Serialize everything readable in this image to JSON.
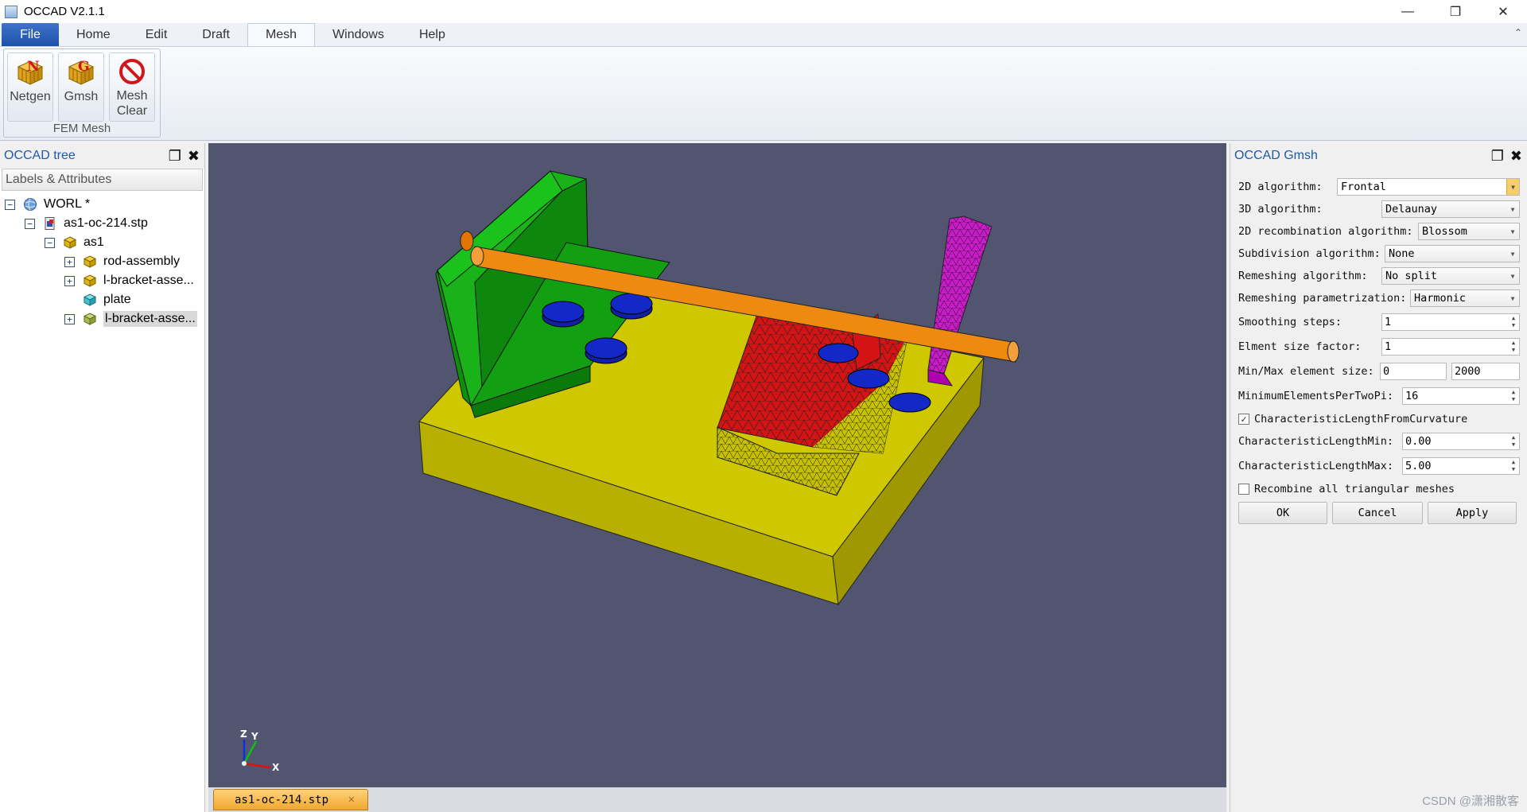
{
  "window": {
    "title": "OCCAD V2.1.1"
  },
  "menu": {
    "tabs": [
      "File",
      "Home",
      "Edit",
      "Draft",
      "Mesh",
      "Windows",
      "Help"
    ],
    "active": "Mesh"
  },
  "ribbon": {
    "group_caption": "FEM Mesh",
    "buttons": [
      {
        "label": "Netgen"
      },
      {
        "label": "Gmsh"
      },
      {
        "label_line1": "Mesh",
        "label_line2": "Clear"
      }
    ]
  },
  "tree_panel": {
    "title": "OCCAD tree",
    "header": "Labels & Attributes",
    "items": [
      {
        "label": "WORL *"
      },
      {
        "label": "as1-oc-214.stp"
      },
      {
        "label": "as1"
      },
      {
        "label": "rod-assembly"
      },
      {
        "label": "l-bracket-asse..."
      },
      {
        "label": "plate"
      },
      {
        "label": "l-bracket-asse..."
      }
    ]
  },
  "viewport": {
    "axis_labels": {
      "z": "Z",
      "y": "Y",
      "x": "X"
    }
  },
  "document_tab": {
    "label": "as1-oc-214.stp"
  },
  "gmsh_panel": {
    "title": "OCCAD Gmsh",
    "algo2d": {
      "label": "2D algorithm:",
      "value": "Frontal"
    },
    "algo3d": {
      "label": "3D algorithm:",
      "value": "Delaunay"
    },
    "recomb2d": {
      "label": "2D recombination algorithm:",
      "value": "Blossom"
    },
    "subdiv": {
      "label": "Subdivision algorithm:",
      "value": "None"
    },
    "remesh": {
      "label": "Remeshing algorithm:",
      "value": "No split"
    },
    "remesh_param": {
      "label": "Remeshing parametrization:",
      "value": "Harmonic"
    },
    "smoothing": {
      "label": "Smoothing steps:",
      "value": "1"
    },
    "size_factor": {
      "label": "Elment size factor:",
      "value": "1"
    },
    "minmax": {
      "label": "Min/Max element size:",
      "min": "0",
      "max": "2000"
    },
    "min_per_2pi": {
      "label": "MinimumElementsPerTwoPi:",
      "value": "16"
    },
    "curvature": {
      "label": "CharacteristicLengthFromCurvature",
      "checked": true
    },
    "cl_min": {
      "label": "CharacteristicLengthMin:",
      "value": "0.00"
    },
    "cl_max": {
      "label": "CharacteristicLengthMax:",
      "value": "5.00"
    },
    "recombine_all": {
      "label": "Recombine all triangular meshes",
      "checked": false
    },
    "buttons": {
      "ok": "OK",
      "cancel": "Cancel",
      "apply": "Apply"
    }
  },
  "watermark": "CSDN @潇湘散客"
}
